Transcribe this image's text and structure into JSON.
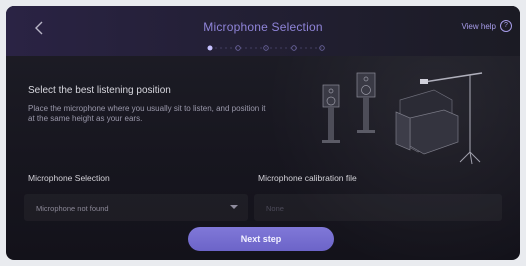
{
  "header": {
    "title": "Microphone Selection",
    "help_label": "View help",
    "help_icon": "?",
    "step_count": 5,
    "current_step": 1
  },
  "content": {
    "heading": "Select the best listening position",
    "description": "Place the microphone where you usually sit to listen, and position it at the same height as your ears."
  },
  "fields": {
    "mic_label": "Microphone Selection",
    "mic_value": "Microphone not found",
    "calibration_label": "Microphone calibration file",
    "calibration_value": "None"
  },
  "actions": {
    "next_label": "Next step"
  },
  "colors": {
    "accent": "#7a72d6",
    "background": "#1b1a23"
  }
}
